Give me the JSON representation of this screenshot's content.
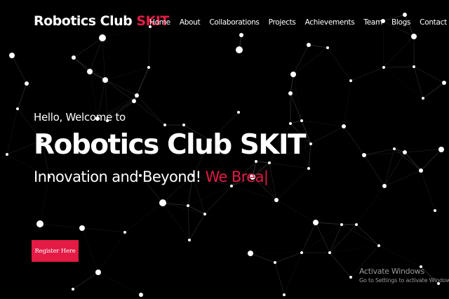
{
  "brand": {
    "name": "Robotics Club",
    "accent": "SKIT"
  },
  "nav": {
    "items": [
      {
        "label": "Home"
      },
      {
        "label": "About"
      },
      {
        "label": "Collaborations"
      },
      {
        "label": "Projects"
      },
      {
        "label": "Achievements"
      },
      {
        "label": "Team"
      },
      {
        "label": "Blogs"
      },
      {
        "label": "Contact Us"
      }
    ]
  },
  "hero": {
    "greeting": "Hello, Welcome to",
    "title": "Robotics Club SKIT",
    "tagline_static": "Innovation and Beyond!",
    "tagline_typed": "We Brea",
    "cursor": "|"
  },
  "register_button": {
    "label": "Register Here"
  },
  "watermark": {
    "title": "Activate Windows",
    "subtitle": "Go to Settings to activate Windows."
  },
  "colors": {
    "background": "#000000",
    "accent": "#e31b45",
    "text": "#ffffff"
  }
}
